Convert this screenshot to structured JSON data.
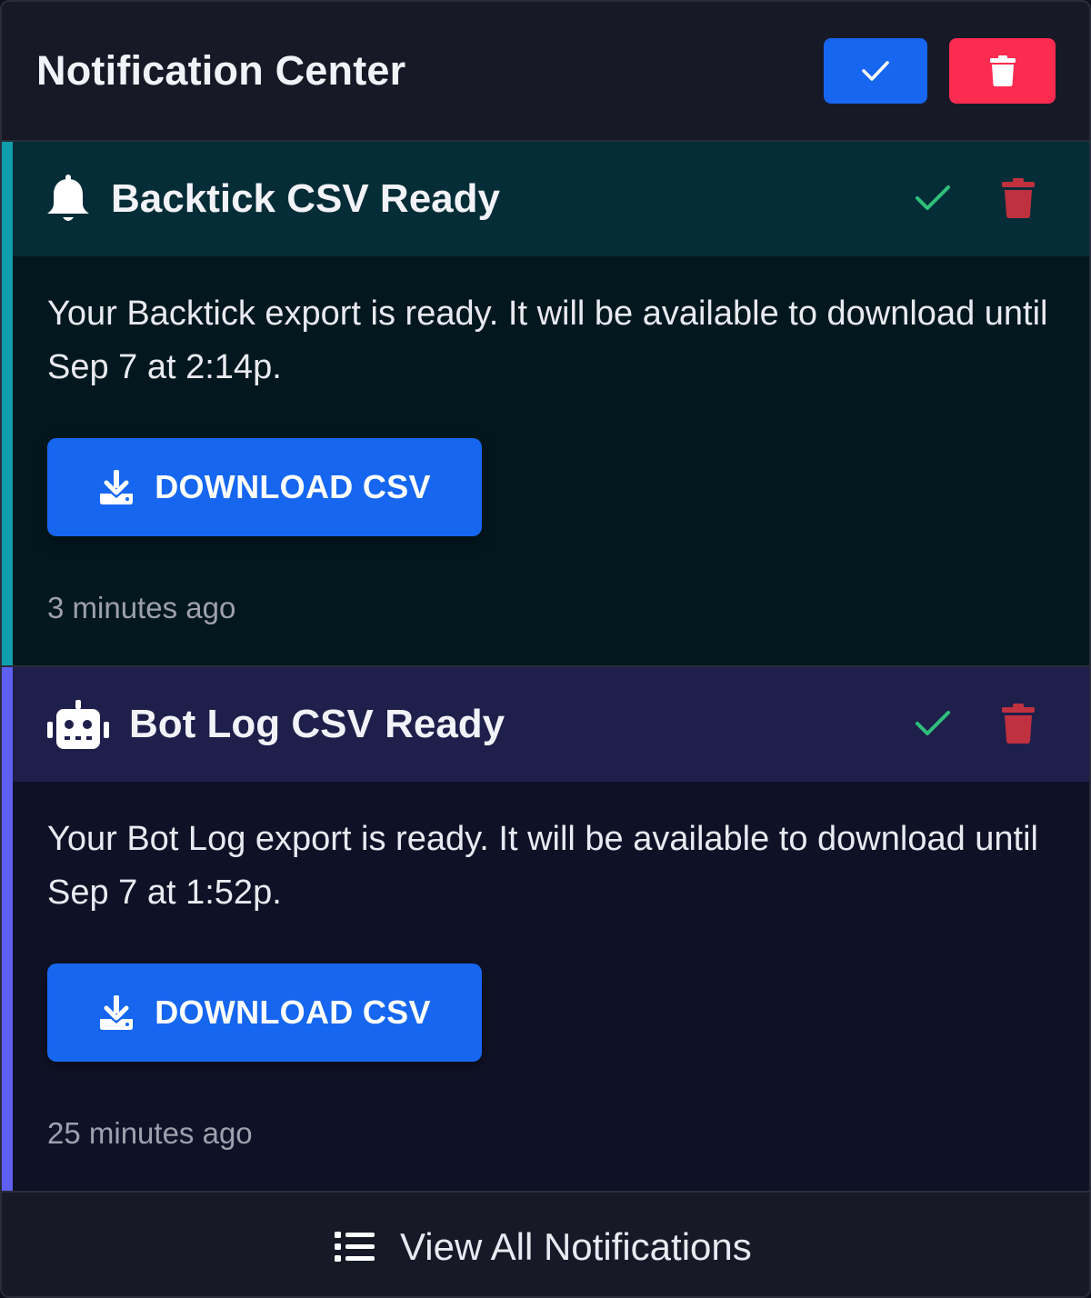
{
  "header": {
    "title": "Notification Center",
    "mark_all_read_icon": "check-icon",
    "delete_all_icon": "trash-icon"
  },
  "notifications": [
    {
      "icon": "bell-icon",
      "title": "Backtick CSV Ready",
      "message": "Your Backtick export is ready. It will be available to download until Sep 7 at 2:14p.",
      "button_label": "DOWNLOAD CSV",
      "time": "3 minutes ago",
      "accent_color": "#109dac"
    },
    {
      "icon": "robot-icon",
      "title": "Bot Log CSV Ready",
      "message": "Your Bot Log export is ready. It will be available to download until Sep 7 at 1:52p.",
      "button_label": "DOWNLOAD CSV",
      "time": "25 minutes ago",
      "accent_color": "#5e5ff0"
    }
  ],
  "footer": {
    "label": "View All Notifications",
    "icon": "list-icon"
  },
  "colors": {
    "primary": "#1666f0",
    "danger": "#fc2c51",
    "success": "#2fbf7c",
    "muted_danger": "#c0313f"
  }
}
